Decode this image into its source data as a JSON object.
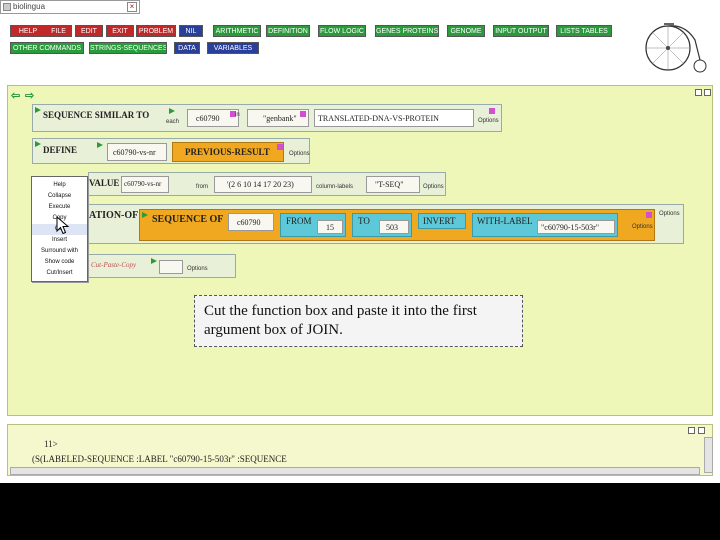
{
  "window": {
    "title": "biolingua"
  },
  "menu": {
    "row1": [
      {
        "label": "HELP",
        "color": "red"
      },
      {
        "label": "FILE",
        "color": "red"
      },
      {
        "label": "EDIT",
        "color": "red"
      },
      {
        "label": "EXIT",
        "color": "red"
      },
      {
        "label": "PROBLEM",
        "color": "red"
      },
      {
        "label": "NIL",
        "color": "blue"
      },
      {
        "label": "ARITHMETIC",
        "color": "green"
      },
      {
        "label": "DEFINITION",
        "color": "green"
      },
      {
        "label": "FLOW LOGIC",
        "color": "green"
      },
      {
        "label": "GENES PROTEINS",
        "color": "green"
      },
      {
        "label": "GENOME",
        "color": "green"
      },
      {
        "label": "INPUT OUTPUT",
        "color": "green"
      },
      {
        "label": "LISTS TABLES",
        "color": "green"
      }
    ],
    "row2": [
      {
        "label": "OTHER COMMANDS",
        "color": "green"
      },
      {
        "label": "STRINGS-SEQUENCES",
        "color": "green"
      },
      {
        "label": "DATA",
        "color": "blue"
      },
      {
        "label": "VARIABLES",
        "color": "blue"
      }
    ]
  },
  "workspace": {
    "line1": {
      "keyword": "SEQUENCE SIMILAR TO",
      "each": "each",
      "arg1": "c60790",
      "in": "in",
      "arg2": "\"genbank\"",
      "arg3": "TRANSLATED-DNA-VS-PROTEIN",
      "options": "Options"
    },
    "line2": {
      "keyword": "DEFINE",
      "arg1": "c60790-vs-nr",
      "arg2": "PREVIOUS-RESULT",
      "options": "Options"
    },
    "line3": {
      "keyword": "VALUE",
      "arg1": "c60790-vs-nr",
      "from": "from",
      "arg2": "'(2 6 10 14 17 20 23)",
      "column": "column-labels",
      "arg3": "\"T-SEQ\"",
      "options": "Options"
    },
    "line4": {
      "keyword": "ATION-OF",
      "inner_keyword": "SEQUENCE OF",
      "arg1": "c60790",
      "from_label": "FROM",
      "from_val": "15",
      "to_label": "TO",
      "to_val": "503",
      "invert": "INVERT",
      "with_label": "WITH-LABEL",
      "label_val": "\"c60790-15-503r\"",
      "options": "Options",
      "outer_options": "Options"
    },
    "line5": {
      "hint": "Cut-Paste-Copy",
      "options": "Options"
    }
  },
  "context_menu": {
    "items": [
      "Help",
      "Collapse",
      "Execute",
      "Copy",
      "Cut",
      "Insert",
      "Surround with",
      "Show code",
      "Cut/Insert"
    ]
  },
  "callout": {
    "text": "Cut the function box and paste it into the first argument box of JOIN."
  },
  "output": {
    "prompt": "11>",
    "result": "(S(LABELED-SEQUENCE :LABEL \"c60790-15-503r\" :SEQUENCE"
  }
}
